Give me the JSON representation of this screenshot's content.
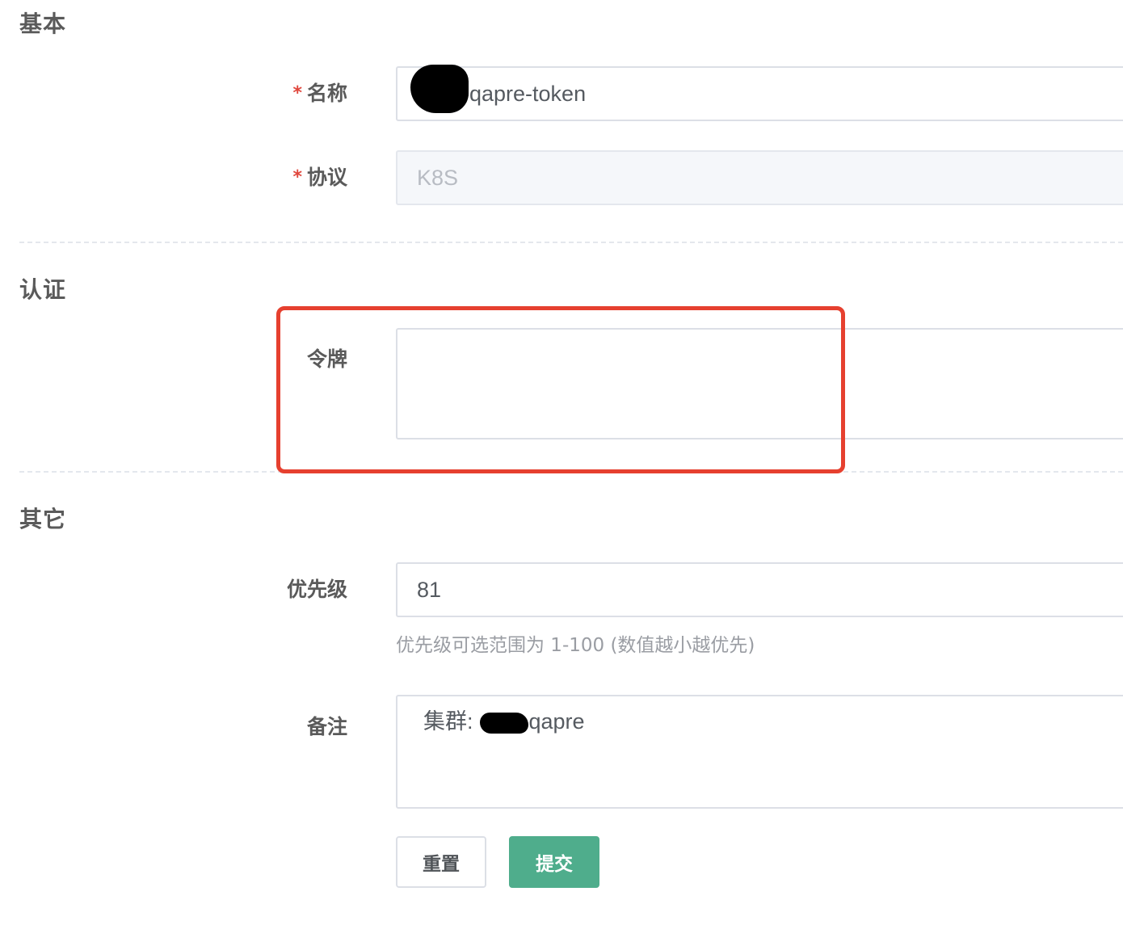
{
  "sections": {
    "basic": "基本",
    "auth": "认证",
    "other": "其它"
  },
  "required_mark": "*",
  "fields": {
    "name": {
      "label": "名称",
      "value": "-qapre-token"
    },
    "protocol": {
      "label": "协议",
      "value": "K8S"
    },
    "token": {
      "label": "令牌",
      "value": ""
    },
    "priority": {
      "label": "优先级",
      "value": "81",
      "hint": "优先级可选范围为 1-100 (数值越小越优先)"
    },
    "remark": {
      "label": "备注",
      "value": "集群:        -qapre"
    }
  },
  "buttons": {
    "reset": "重置",
    "submit": "提交"
  },
  "colors": {
    "highlight": "#e6402f",
    "submit": "#4fad8c",
    "required": "#e0463c"
  }
}
